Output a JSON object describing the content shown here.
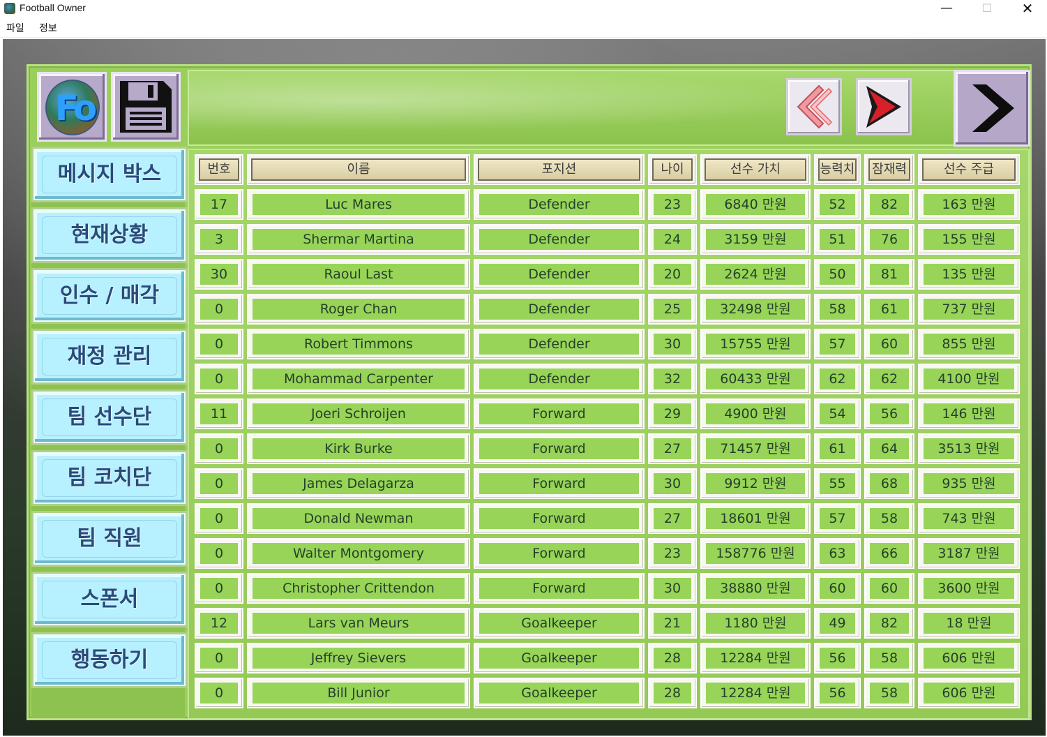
{
  "window": {
    "title": "Football Owner",
    "minimize": "—",
    "maximize": "☐",
    "close": "✕"
  },
  "menu": {
    "file": "파일",
    "info": "정보"
  },
  "side_menu": [
    {
      "id": "message",
      "label": "메시지 박스"
    },
    {
      "id": "status",
      "label": "현재상황"
    },
    {
      "id": "trade",
      "label": "인수 / 매각"
    },
    {
      "id": "finance",
      "label": "재정 관리"
    },
    {
      "id": "squad",
      "label": "팀 선수단"
    },
    {
      "id": "coaches",
      "label": "팀 코치단"
    },
    {
      "id": "staff",
      "label": "팀 직원"
    },
    {
      "id": "sponsor",
      "label": "스폰서"
    },
    {
      "id": "action",
      "label": "행동하기"
    }
  ],
  "toolbar": {
    "logo_icon": "fo-logo-icon",
    "save_icon": "floppy-disk-icon",
    "prev_icon": "double-chevron-left-icon",
    "next_icon": "chevron-right-icon",
    "forward_icon": "large-chevron-right-icon"
  },
  "table": {
    "headers": [
      "번호",
      "이름",
      "포지션",
      "나이",
      "선수 가치",
      "능력치",
      "잠재력",
      "선수 주급"
    ],
    "rows": [
      [
        "17",
        "Luc Mares",
        "Defender",
        "23",
        "6840 만원",
        "52",
        "82",
        "163 만원"
      ],
      [
        "3",
        "Shermar Martina",
        "Defender",
        "24",
        "3159 만원",
        "51",
        "76",
        "155 만원"
      ],
      [
        "30",
        "Raoul Last",
        "Defender",
        "20",
        "2624 만원",
        "50",
        "81",
        "135 만원"
      ],
      [
        "0",
        "Roger Chan",
        "Defender",
        "25",
        "32498 만원",
        "58",
        "61",
        "737 만원"
      ],
      [
        "0",
        "Robert Timmons",
        "Defender",
        "30",
        "15755 만원",
        "57",
        "60",
        "855 만원"
      ],
      [
        "0",
        "Mohammad Carpenter",
        "Defender",
        "32",
        "60433 만원",
        "62",
        "62",
        "4100 만원"
      ],
      [
        "11",
        "Joeri Schroijen",
        "Forward",
        "29",
        "4900 만원",
        "54",
        "56",
        "146 만원"
      ],
      [
        "0",
        "Kirk Burke",
        "Forward",
        "27",
        "71457 만원",
        "61",
        "64",
        "3513 만원"
      ],
      [
        "0",
        "James Delagarza",
        "Forward",
        "30",
        "9912 만원",
        "55",
        "68",
        "935 만원"
      ],
      [
        "0",
        "Donald Newman",
        "Forward",
        "27",
        "18601 만원",
        "57",
        "58",
        "743 만원"
      ],
      [
        "0",
        "Walter Montgomery",
        "Forward",
        "23",
        "158776 만원",
        "63",
        "66",
        "3187 만원"
      ],
      [
        "0",
        "Christopher Crittendon",
        "Forward",
        "30",
        "38880 만원",
        "60",
        "60",
        "3600 만원"
      ],
      [
        "12",
        "Lars van Meurs",
        "Goalkeeper",
        "21",
        "1180 만원",
        "49",
        "82",
        "18 만원"
      ],
      [
        "0",
        "Jeffrey Sievers",
        "Goalkeeper",
        "28",
        "12284 만원",
        "56",
        "58",
        "606 만원"
      ],
      [
        "0",
        "Bill Junior",
        "Goalkeeper",
        "28",
        "12284 만원",
        "56",
        "58",
        "606 만원"
      ]
    ]
  },
  "colors": {
    "frame_green": "#9bcf5c",
    "cell_green": "#97d458",
    "button_cyan": "#b7f0ff",
    "button_text": "#2b4a7a",
    "nav_red": "#d8202a",
    "header_tan": "#d8cda4"
  }
}
